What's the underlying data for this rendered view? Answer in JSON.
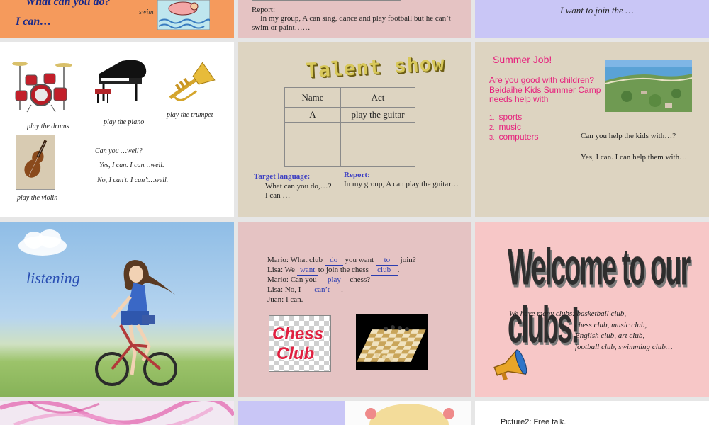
{
  "slides": {
    "s1": {
      "line1": "What can you do?",
      "line2": "I can…",
      "caption": "swim"
    },
    "s2": {
      "report_title": "Report:",
      "report_body": "In my group, A can sing, dance and play football but he can’t swim or paint……"
    },
    "s3": {
      "line1": "I want to join the …"
    },
    "s4": {
      "drums": "play the drums",
      "piano": "play the piano",
      "trumpet": "play the trumpet",
      "violin": "play the violin",
      "q": "Can you …well?",
      "yes": "Yes, I can. I can…well.",
      "no": "No, I can’t. I can’t…well."
    },
    "s5": {
      "title": "Talent show",
      "col_name": "Name",
      "col_act": "Act",
      "row1_name": "A",
      "row1_act": "play the guitar",
      "target_label": "Target language:",
      "target_l1": "What can you do,…?",
      "target_l2": "I can …",
      "report_label": "Report:",
      "report_text": "In my group, A can play the guitar…"
    },
    "s6": {
      "title": "Summer Job!",
      "intro1": "Are you good with children?",
      "intro2": "Beidaihe Kids Summer Camp",
      "intro3": "needs help with",
      "items": [
        {
          "n": "1.",
          "t": "sports"
        },
        {
          "n": "2.",
          "t": "music"
        },
        {
          "n": "3.",
          "t": "computers"
        }
      ],
      "q": "Can you help the kids with…?",
      "a": "Yes, I can. I can help them with…"
    },
    "s7": {
      "label": "listening"
    },
    "s8": {
      "l1a": "Mario: What club",
      "l1f1": "do",
      "l1b": "you want",
      "l1f2": "to",
      "l1c": "join?",
      "l2a": "Lisa:   We",
      "l2f1": "want",
      "l2b": "to join the chess",
      "l2f2": "club",
      "l2c": ".",
      "l3a": "Mario: Can you",
      "l3f1": "play",
      "l3b": "chess?",
      "l4a": "Lisa:   No, I",
      "l4f1": "can’t",
      "l4b": ".",
      "l5a": "Juan:   I can.",
      "chess_word1": "Chess",
      "chess_word2": "Club"
    },
    "s9": {
      "title": "Welcome to our clubs!",
      "l1": "We have many clubs: basketball club,",
      "l2": "chess club, music club,",
      "l3": "English club, art club,",
      "l4": "football club, swimming club…"
    },
    "s12": {
      "text": "Picture2: Free talk."
    }
  },
  "colors": {
    "orange_bg": "#f59a5c",
    "pink_bg": "#e5c3c3",
    "lavender_bg": "#c9c6f6",
    "white_bg": "#ffffff",
    "beige_bg": "#ddd4c1",
    "sky": "#9ec6e9",
    "grass": "#9cc36a",
    "pink_welcome": "#f7c7c7",
    "magenta": "#e6227d",
    "blue_label": "#3d3fc2",
    "blue_text": "#2a3db0"
  },
  "icons": [
    "drum-kit-icon",
    "grand-piano-icon",
    "trumpet-icon",
    "violin-icon",
    "beach-photo",
    "girl-on-bike-illustration",
    "chess-club-sign",
    "chess-board-icon",
    "megaphone-icon",
    "swimmer-illustration"
  ]
}
